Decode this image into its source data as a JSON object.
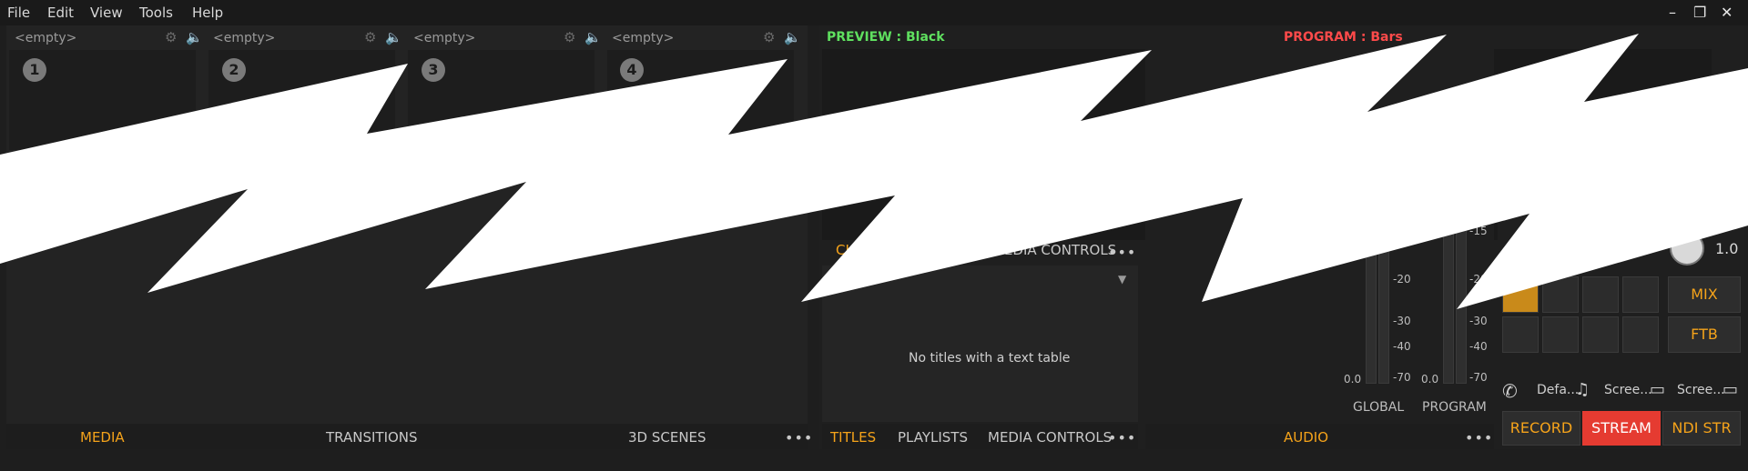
{
  "menu": [
    "File",
    "Edit",
    "View",
    "Tools",
    "Help"
  ],
  "window_controls": {
    "minimize": "–",
    "restore": "❐",
    "close": "✕"
  },
  "slots": [
    {
      "head": "<empty>",
      "num": "1"
    },
    {
      "head": "<empty>",
      "num": "2"
    },
    {
      "head": "<empty>",
      "num": "3"
    },
    {
      "head": "<empty>",
      "num": "4"
    }
  ],
  "left_tabs": [
    "MEDIA",
    "TRANSITIONS",
    "3D SCENES"
  ],
  "left_active_tab": "MEDIA",
  "preview_label": "PREVIEW : Black",
  "program_label": "PROGRAM : Bars",
  "middle_tabs_partial": [
    "CL",
    "MEDIA CONTROLS"
  ],
  "titles_empty_message": "No titles with a text table",
  "bottom_tabs": [
    "TITLES",
    "PLAYLISTS",
    "MEDIA CONTROLS"
  ],
  "bottom_active_tab": "TITLES",
  "audio_tab": "AUDIO",
  "meters": {
    "global": {
      "label": "GLOBAL",
      "value": "0.0",
      "scale": [
        "-20",
        "-30",
        "-40",
        "-70"
      ]
    },
    "program": {
      "label": "PROGRAM",
      "value": "0.0",
      "scale": [
        "-15",
        "-20",
        "-30",
        "-40",
        "-70"
      ]
    }
  },
  "knob_value": "1.0",
  "mix_label": "MIX",
  "ftb_label": "FTB",
  "devices": [
    "Defa...",
    "Scree...",
    "Scree..."
  ],
  "actions": {
    "record": "RECORD",
    "stream": "STREAM",
    "ndi": "NDI STR"
  },
  "colors": {
    "accent": "#f5a31a",
    "preview": "#5fe05f",
    "program": "#ff4a4a",
    "stream": "#e53b31"
  }
}
